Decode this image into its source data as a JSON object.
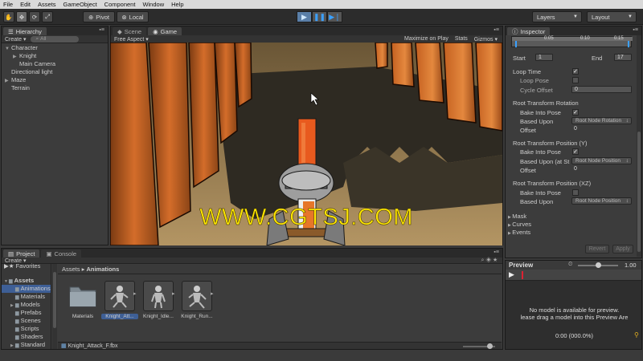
{
  "menu": [
    "File",
    "Edit",
    "Assets",
    "GameObject",
    "Component",
    "Window",
    "Help"
  ],
  "toolbar": {
    "pivot": "Pivot",
    "local": "Local",
    "layers": "Layers",
    "layout": "Layout"
  },
  "hierarchy": {
    "tab": "Hierarchy",
    "create": "Create",
    "search_placeholder": "All",
    "items": [
      {
        "label": "Character",
        "indent": 0,
        "arrow": "▼"
      },
      {
        "label": "Knight",
        "indent": 1,
        "arrow": "▶"
      },
      {
        "label": "Main Camera",
        "indent": 1,
        "arrow": ""
      },
      {
        "label": "Directional light",
        "indent": 0,
        "arrow": ""
      },
      {
        "label": "Maze",
        "indent": 0,
        "arrow": "▶"
      },
      {
        "label": "Terrain",
        "indent": 0,
        "arrow": ""
      }
    ]
  },
  "game": {
    "tabs": [
      "Scene",
      "Game"
    ],
    "aspect": "Free Aspect",
    "maximize": "Maximize on Play",
    "stats": "Stats",
    "gizmos": "Gizmos",
    "watermark": "WWW.CGTSJ.COM"
  },
  "inspector": {
    "tab": "Inspector",
    "timeline_ticks": [
      "0:05",
      "0:10",
      "0:15"
    ],
    "start_label": "Start",
    "start_value": "1",
    "end_label": "End",
    "end_value": "17",
    "loop_time": "Loop Time",
    "loop_pose": "Loop Pose",
    "cycle_offset": "Cycle Offset",
    "cycle_offset_value": "0",
    "rtr_header": "Root Transform Rotation",
    "bake_into_pose": "Bake Into Pose",
    "based_upon": "Based Upon",
    "rtr_based_value": "Root Node Rotation",
    "offset": "Offset",
    "offset_value": "0",
    "rtpy_header": "Root Transform Position (Y)",
    "based_upon_at": "Based Upon (at St",
    "rtpy_based_value": "Root Node Position",
    "rtpxz_header": "Root Transform Position (XZ)",
    "rtpxz_based_value": "Root Node Position",
    "foldouts": [
      "Mask",
      "Curves",
      "Events"
    ],
    "revert": "Revert",
    "apply": "Apply"
  },
  "preview": {
    "title": "Preview",
    "speed": "1.00",
    "message_line1": "No model is available for preview.",
    "message_line2": "lease drag a model into this Preview Are",
    "time": "0:00 (000.0%)"
  },
  "project": {
    "tabs": [
      "Project",
      "Console"
    ],
    "create": "Create",
    "favorites": "Favorites",
    "tree": [
      {
        "label": "Assets",
        "indent": 0,
        "arrow": "▼"
      },
      {
        "label": "Animations",
        "indent": 1,
        "arrow": "",
        "selected": true
      },
      {
        "label": "Materials",
        "indent": 1,
        "arrow": ""
      },
      {
        "label": "Models",
        "indent": 1,
        "arrow": "▶"
      },
      {
        "label": "Prefabs",
        "indent": 1,
        "arrow": ""
      },
      {
        "label": "Scenes",
        "indent": 1,
        "arrow": ""
      },
      {
        "label": "Scripts",
        "indent": 1,
        "arrow": ""
      },
      {
        "label": "Shaders",
        "indent": 1,
        "arrow": ""
      },
      {
        "label": "Standard",
        "indent": 1,
        "arrow": "▶"
      }
    ],
    "breadcrumb_root": "Assets",
    "breadcrumb_sep": "▸",
    "breadcrumb_current": "Animations",
    "assets": [
      {
        "label": "Materials",
        "kind": "folder"
      },
      {
        "label": "Knight_Att...",
        "kind": "anim",
        "selected": true
      },
      {
        "label": "Knight_Idle...",
        "kind": "anim"
      },
      {
        "label": "Knight_Run...",
        "kind": "anim"
      }
    ],
    "status_file": "Knight_Attack_F.fbx"
  },
  "colors": {
    "accent": "#3aa0ff",
    "watermark": "#ffe600",
    "panel_bg": "#3c3c3c",
    "selection": "#3e5f96"
  }
}
